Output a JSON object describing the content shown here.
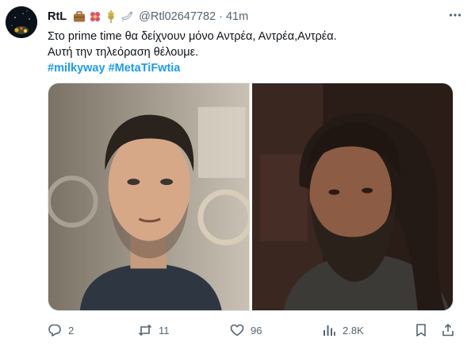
{
  "tweet": {
    "author": {
      "name": "RtL",
      "handle": "@Rtl02647782",
      "emojis": [
        "briefcase-emoji",
        "flower-emoji",
        "wheat-emoji",
        "dove-emoji"
      ]
    },
    "separator": "·",
    "time": "41m",
    "text_lines": [
      "Στο prime time θα δείχνουν μόνο Αντρέα, Αντρέα,Αντρέα.",
      "Αυτή την τηλεόραση θέλουμε."
    ],
    "hashtags": [
      "#milkyway",
      "#MetaTiFwtia"
    ],
    "actions": {
      "reply": {
        "icon": "reply-icon",
        "count": "2"
      },
      "retweet": {
        "icon": "retweet-icon",
        "count": "11"
      },
      "like": {
        "icon": "heart-icon",
        "count": "96"
      },
      "views": {
        "icon": "analytics-icon",
        "count": "2.8K"
      },
      "bookmark": {
        "icon": "bookmark-icon"
      },
      "share": {
        "icon": "share-icon"
      }
    }
  },
  "colors": {
    "text": "#0f1419",
    "muted": "#536471",
    "link": "#1d9bf0"
  }
}
